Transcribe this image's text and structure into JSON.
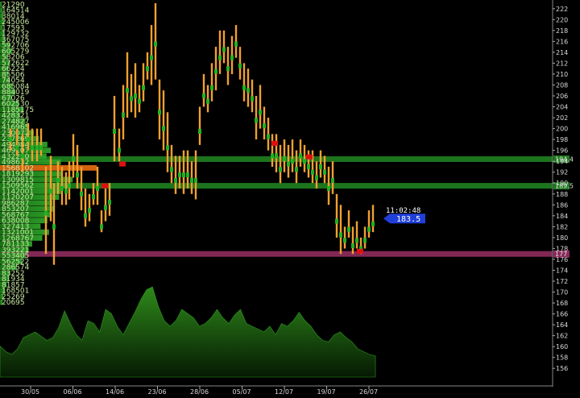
{
  "chart_data": {
    "type": "candlestick-volume-profile",
    "y_axis": {
      "min": 155,
      "max": 223,
      "ticks": [
        156,
        158,
        160,
        162,
        164,
        166,
        168,
        170,
        172,
        174,
        176,
        178,
        180,
        182,
        184,
        186,
        188,
        190,
        192,
        194,
        196,
        198,
        200,
        202,
        204,
        206,
        208,
        210,
        212,
        214,
        216,
        218,
        220,
        222
      ]
    },
    "x_labels": [
      "30/05",
      "06/06",
      "14/06",
      "23/06",
      "28/06",
      "05/07",
      "12/07",
      "19/07",
      "26/07"
    ],
    "volume_profile": {
      "labels": [
        "21290",
        "164514",
        "38014",
        "245006",
        "17593",
        "129732",
        "367075",
        "592706",
        "605279",
        "58206",
        "572622",
        "66224",
        "85506",
        "74054",
        "685084",
        "884019",
        "67026",
        "602530",
        "1185175",
        "428321",
        "274827",
        "416965",
        "230072",
        "237269",
        "494084",
        "469107",
        "432250",
        "498632",
        "1568102",
        "1819293",
        "1309815",
        "1509562",
        "1142001",
        "1120207",
        "986287",
        "853207",
        "568767",
        "638008",
        "327413",
        "1321001",
        "1268767",
        "781133",
        "393221",
        "553405",
        "562522",
        "286574",
        "83252",
        "81934",
        "81857",
        "168501",
        "25269",
        "20695"
      ],
      "widths": [
        2,
        3,
        4,
        5,
        3,
        5,
        6,
        12,
        14,
        9,
        12,
        10,
        10,
        11,
        15,
        18,
        14,
        22,
        28,
        24,
        30,
        34,
        40,
        46,
        56,
        60,
        55,
        72,
        80,
        74,
        86,
        80,
        72,
        70,
        62,
        64,
        60,
        56,
        48,
        58,
        50,
        38,
        34,
        30,
        26,
        20,
        12,
        10,
        8,
        6,
        4,
        3
      ],
      "highlight_index": 28
    },
    "levels": [
      {
        "price": 194.4,
        "label": "194.4",
        "color": "#1e7a1e"
      },
      {
        "price": 189.5,
        "label": "189.5",
        "color": "#1e7a1e"
      },
      {
        "price": 177.0,
        "label": "177",
        "color": "#8a2a5a"
      }
    ],
    "bars": [
      [
        13,
        200,
        200,
        196
      ],
      [
        21,
        198,
        200,
        195
      ],
      [
        28,
        198,
        199,
        192
      ],
      [
        35,
        200,
        201,
        196
      ],
      [
        40,
        199,
        200,
        194
      ],
      [
        46,
        199,
        200,
        194
      ],
      [
        51,
        198,
        200,
        195
      ],
      [
        57,
        192,
        193,
        177
      ],
      [
        63,
        194,
        195,
        183
      ],
      [
        67,
        189,
        190,
        175
      ],
      [
        72,
        193,
        194,
        188
      ],
      [
        77,
        192,
        193,
        186
      ],
      [
        82,
        191,
        192,
        186
      ],
      [
        86,
        192,
        194,
        187
      ],
      [
        91,
        198,
        199,
        191
      ],
      [
        96,
        194,
        197,
        189
      ],
      [
        101,
        191,
        193,
        185
      ],
      [
        106,
        186,
        189,
        182
      ],
      [
        111,
        187,
        188,
        183
      ],
      [
        116,
        189,
        190,
        186
      ],
      [
        121,
        192,
        193,
        186
      ],
      [
        126,
        183,
        185,
        181
      ],
      [
        131,
        188,
        189,
        183
      ],
      [
        136,
        189,
        190,
        184
      ],
      [
        142,
        205,
        206,
        194
      ],
      [
        148,
        198,
        200,
        194
      ],
      [
        153,
        207,
        208,
        198
      ],
      [
        158,
        212,
        214,
        202
      ],
      [
        163,
        208,
        210,
        203
      ],
      [
        168,
        210,
        212,
        202
      ],
      [
        173,
        207,
        208,
        203
      ],
      [
        178,
        210,
        212,
        205
      ],
      [
        183,
        213,
        214,
        209
      ],
      [
        188,
        218,
        219,
        208
      ],
      [
        193,
        222,
        223,
        209
      ],
      [
        198,
        208,
        209,
        198
      ],
      [
        203,
        204,
        207,
        196
      ],
      [
        208,
        201,
        203,
        192
      ],
      [
        213,
        195,
        197,
        190
      ],
      [
        218,
        193,
        195,
        188
      ],
      [
        223,
        194,
        195,
        189
      ],
      [
        228,
        195,
        196,
        188
      ],
      [
        233,
        194,
        196,
        189
      ],
      [
        238,
        193,
        194,
        188
      ],
      [
        243,
        194,
        196,
        187
      ],
      [
        248,
        202,
        204,
        197
      ],
      [
        253,
        208,
        210,
        204
      ],
      [
        258,
        207,
        208,
        203
      ],
      [
        263,
        210,
        212,
        205
      ],
      [
        268,
        214,
        215,
        207
      ],
      [
        273,
        216,
        218,
        210
      ],
      [
        278,
        217,
        218,
        212
      ],
      [
        283,
        214,
        215,
        208
      ],
      [
        288,
        216,
        217,
        210
      ],
      [
        293,
        218,
        219,
        213
      ],
      [
        298,
        214,
        215,
        209
      ],
      [
        303,
        210,
        212,
        205
      ],
      [
        308,
        210,
        211,
        204
      ],
      [
        313,
        208,
        209,
        203
      ],
      [
        318,
        205,
        206,
        198
      ],
      [
        323,
        206,
        208,
        200
      ],
      [
        328,
        203,
        204,
        198
      ],
      [
        333,
        201,
        202,
        196
      ],
      [
        338,
        197,
        199,
        193
      ],
      [
        343,
        198,
        199,
        192
      ],
      [
        348,
        195,
        197,
        190
      ],
      [
        353,
        197,
        198,
        192
      ],
      [
        358,
        196,
        197,
        191
      ],
      [
        363,
        196,
        198,
        192
      ],
      [
        368,
        195,
        196,
        190
      ],
      [
        373,
        197,
        198,
        193
      ],
      [
        378,
        196,
        197,
        192
      ],
      [
        383,
        195,
        196,
        191
      ],
      [
        388,
        194,
        196,
        190
      ],
      [
        393,
        193,
        194,
        189
      ],
      [
        398,
        195,
        196,
        191
      ],
      [
        403,
        194,
        195,
        190
      ],
      [
        408,
        192,
        193,
        186
      ],
      [
        413,
        193,
        194,
        188
      ],
      [
        418,
        186,
        188,
        180
      ],
      [
        423,
        184,
        186,
        177
      ],
      [
        428,
        181,
        182,
        178
      ],
      [
        433,
        183,
        185,
        180
      ],
      [
        438,
        180,
        182,
        177
      ],
      [
        443,
        181,
        183,
        178
      ],
      [
        448,
        179,
        180,
        177
      ],
      [
        453,
        181,
        182,
        178
      ],
      [
        458,
        183,
        185,
        180
      ],
      [
        463,
        184,
        186,
        181
      ]
    ],
    "markers": [
      [
        152,
        193.5
      ],
      [
        130,
        189.5
      ],
      [
        341,
        197.3
      ],
      [
        384,
        194.8
      ],
      [
        447,
        177.5
      ]
    ],
    "volume_series": [
      22,
      18,
      16,
      20,
      28,
      30,
      32,
      29,
      26,
      28,
      35,
      47,
      38,
      30,
      26,
      40,
      38,
      32,
      48,
      45,
      36,
      30,
      38,
      46,
      55,
      62,
      64,
      50,
      40,
      36,
      40,
      48,
      45,
      42,
      36,
      38,
      42,
      48,
      42,
      38,
      44,
      48,
      38,
      36,
      34,
      32,
      36,
      30,
      38,
      36,
      40,
      46,
      40,
      36,
      30,
      26,
      25,
      30,
      32,
      28,
      25,
      20,
      18,
      16,
      15
    ],
    "current": {
      "time": "11:02:48",
      "price": "183.5"
    }
  }
}
